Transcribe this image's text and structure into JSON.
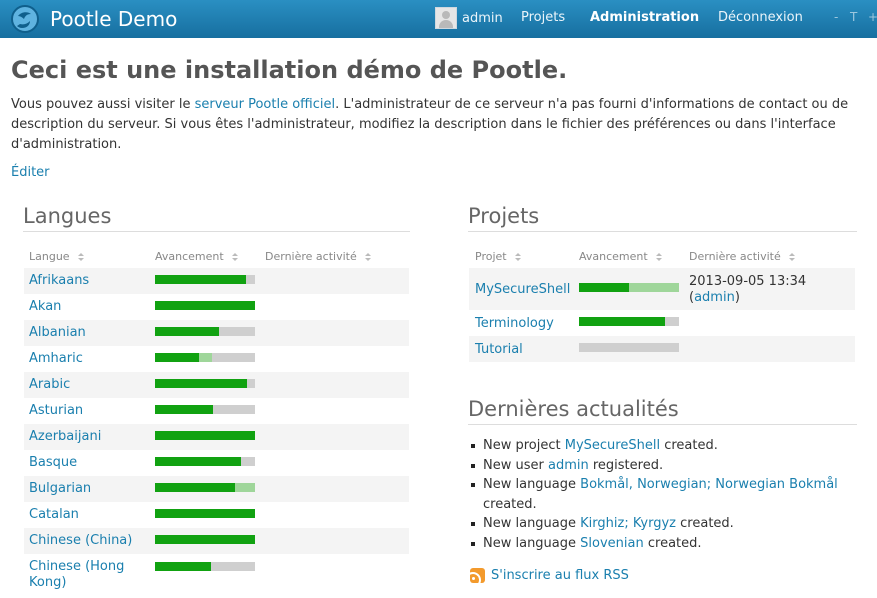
{
  "header": {
    "brand": "Pootle Demo",
    "user": "admin",
    "nav": [
      "Projets",
      "Administration",
      "Déconnexion"
    ],
    "active": "Administration",
    "font_controls": [
      "-",
      "T",
      "+"
    ]
  },
  "intro": {
    "title": "Ceci est une installation démo de Pootle.",
    "text_before_link": "Vous pouvez aussi visiter le ",
    "link": "serveur Pootle officiel",
    "text_after_link": ". L'administrateur de ce serveur n'a pas fourni d'informations de contact ou de description du serveur. Si vous êtes l'administrateur, modifiez la description dans le fichier des préférences ou dans l'interface d'administration.",
    "edit": "Éditer"
  },
  "languages": {
    "heading": "Langues",
    "columns": [
      "Langue",
      "Avancement",
      "Dernière activité"
    ],
    "rows": [
      {
        "name": "Afrikaans",
        "translated": 0.91,
        "fuzzy": 0.0
      },
      {
        "name": "Akan",
        "translated": 1.0,
        "fuzzy": 0.0
      },
      {
        "name": "Albanian",
        "translated": 0.64,
        "fuzzy": 0.0
      },
      {
        "name": "Amharic",
        "translated": 0.44,
        "fuzzy": 0.13
      },
      {
        "name": "Arabic",
        "translated": 0.92,
        "fuzzy": 0.0
      },
      {
        "name": "Asturian",
        "translated": 0.58,
        "fuzzy": 0.0
      },
      {
        "name": "Azerbaijani",
        "translated": 1.0,
        "fuzzy": 0.0
      },
      {
        "name": "Basque",
        "translated": 0.86,
        "fuzzy": 0.0
      },
      {
        "name": "Bulgarian",
        "translated": 0.8,
        "fuzzy": 0.2
      },
      {
        "name": "Catalan",
        "translated": 1.0,
        "fuzzy": 0.0
      },
      {
        "name": "Chinese (China)",
        "translated": 1.0,
        "fuzzy": 0.0
      },
      {
        "name": "Chinese (Hong Kong)",
        "translated": 0.56,
        "fuzzy": 0.0
      }
    ]
  },
  "projects": {
    "heading": "Projets",
    "columns": [
      "Projet",
      "Avancement",
      "Dernière activité"
    ],
    "rows": [
      {
        "name": "MySecureShell",
        "translated": 0.5,
        "fuzzy": 0.5,
        "activity_date": "2013-09-05 13:34",
        "activity_user": "admin"
      },
      {
        "name": "Terminology",
        "translated": 0.86,
        "fuzzy": 0.0
      },
      {
        "name": "Tutorial",
        "translated": 0.0,
        "fuzzy": 0.0
      }
    ]
  },
  "news": {
    "heading": "Dernières actualités",
    "items": [
      {
        "before": "New project ",
        "link": "MySecureShell",
        "after": " created."
      },
      {
        "before": "New user ",
        "link": "admin",
        "after": " registered."
      },
      {
        "before": "New language ",
        "link": "Bokmål, Norwegian; Norwegian Bokmål",
        "after": " created."
      },
      {
        "before": "New language ",
        "link": "Kirghiz; Kyrgyz",
        "after": " created."
      },
      {
        "before": "New language ",
        "link": "Slovenian",
        "after": " created."
      }
    ],
    "rss": "S'inscrire au flux RSS"
  },
  "colors": {
    "header": "#2a8fc2",
    "link": "#1a7fae",
    "translated": "#11a211",
    "fuzzy": "#9fd69a",
    "untranslated": "#cfcfcf"
  }
}
